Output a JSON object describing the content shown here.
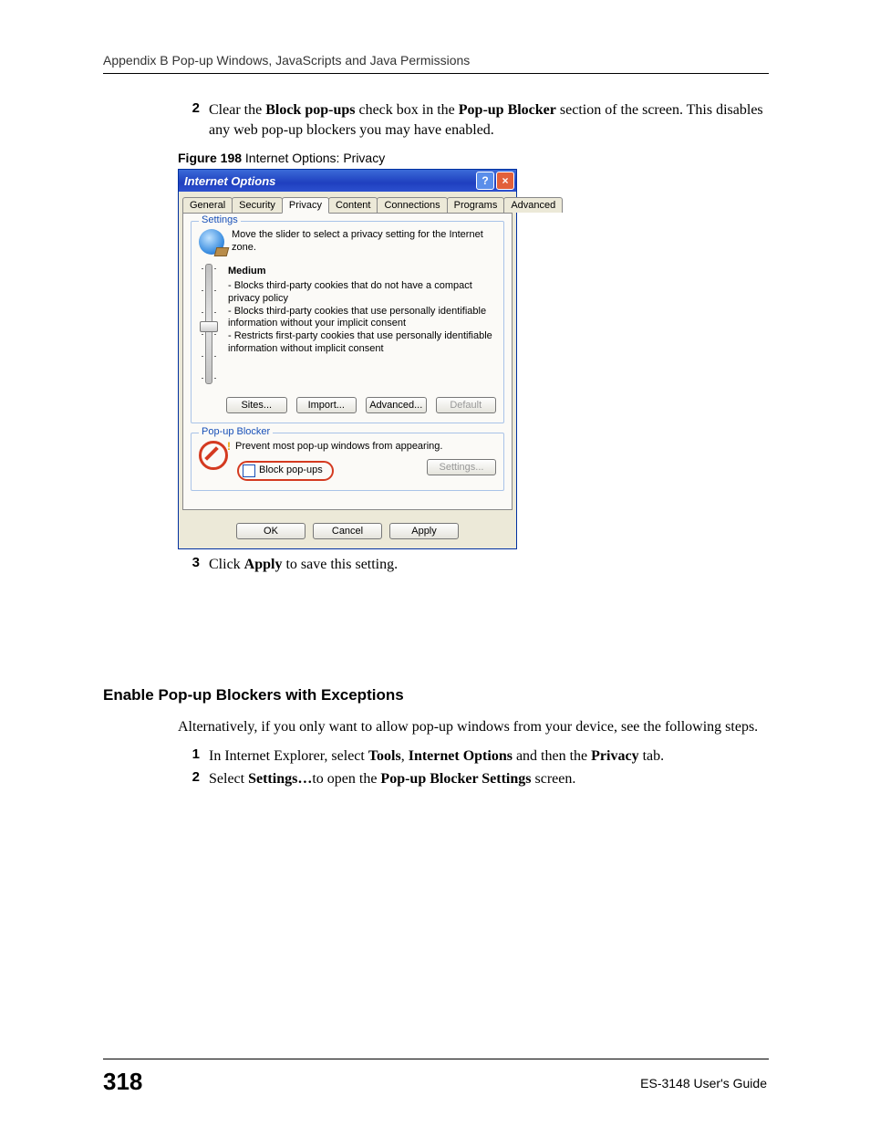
{
  "header": {
    "running_head": "Appendix B Pop-up Windows, JavaScripts and Java Permissions"
  },
  "step2": {
    "num": "2",
    "pre": "Clear the ",
    "b1": "Block pop-ups",
    "mid1": " check box in the ",
    "b2": "Pop-up Blocker",
    "post": " section of the screen. This disables any web pop-up blockers you may have enabled."
  },
  "figcap": {
    "bold": "Figure 198",
    "rest": "   Internet Options: Privacy"
  },
  "dlg": {
    "title": "Internet Options",
    "help": "?",
    "close": "×",
    "tabs": [
      "General",
      "Security",
      "Privacy",
      "Content",
      "Connections",
      "Programs",
      "Advanced"
    ],
    "settings_group": "Settings",
    "settings_desc": "Move the slider to select a privacy setting for the Internet zone.",
    "level": "Medium",
    "bullet1": "- Blocks third-party cookies that do not have a compact privacy policy",
    "bullet2": "- Blocks third-party cookies that use personally identifiable information without your implicit consent",
    "bullet3": "- Restricts first-party cookies that use personally identifiable information without implicit consent",
    "btn_sites": "Sites...",
    "btn_import": "Import...",
    "btn_adv": "Advanced...",
    "btn_default": "Default",
    "popup_group": "Pop-up Blocker",
    "popup_desc": "Prevent most pop-up windows from appearing.",
    "cb_label": "Block pop-ups",
    "btn_settings": "Settings...",
    "btn_ok": "OK",
    "btn_cancel": "Cancel",
    "btn_apply": "Apply"
  },
  "step3": {
    "num": "3",
    "pre": "Click ",
    "b1": "Apply",
    "post": " to save this setting."
  },
  "section_title": "Enable Pop-up Blockers with Exceptions",
  "para_excep": "Alternatively, if you only want to allow pop-up windows from your device, see the following steps.",
  "stepE1": {
    "num": "1",
    "pre": "In Internet Explorer, select ",
    "b1": "Tools",
    "c1": ", ",
    "b2": "Internet Options",
    "mid": " and then the ",
    "b3": "Privacy",
    "post": " tab."
  },
  "stepE2": {
    "num": "2",
    "pre": "Select ",
    "b1": "Settings…",
    "mid": "to open the ",
    "b2": "Pop-up Blocker Settings",
    "post": " screen."
  },
  "footer": {
    "pagenum": "318",
    "guide": "ES-3148 User's Guide"
  }
}
